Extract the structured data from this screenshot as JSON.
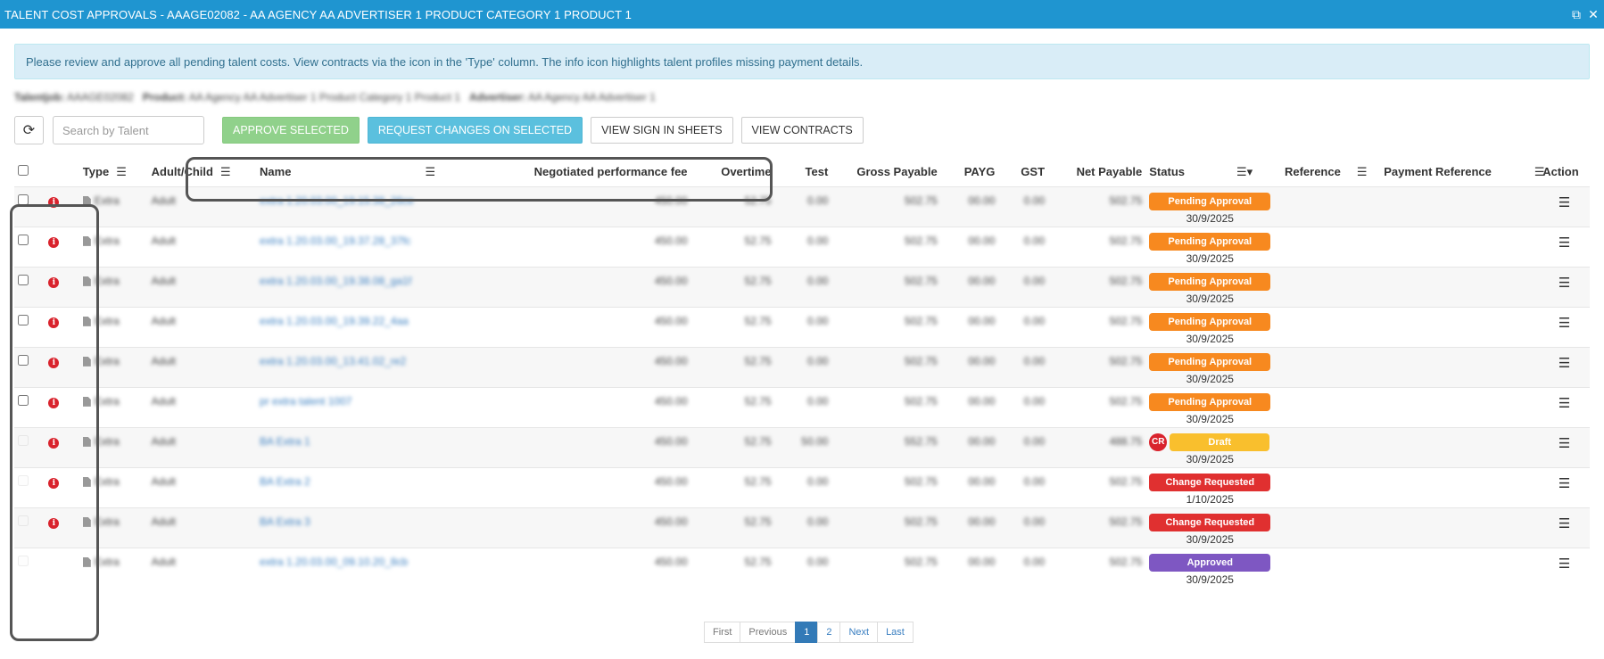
{
  "window": {
    "title": "TALENT COST APPROVALS - AAAGE02082 - AA AGENCY AA ADVERTISER 1 PRODUCT CATEGORY 1 PRODUCT 1",
    "restore_glyph": "⧉",
    "close_glyph": "✕"
  },
  "info_banner": "Please review and approve all pending talent costs. View contracts via the icon in the 'Type' column. The info icon highlights talent profiles missing payment details.",
  "meta_line": {
    "label1": "Talentjob:",
    "value1": "AAAGE02082",
    "label2": "Product:",
    "value2": "AA Agency AA Advertiser 1 Product Category 1 Product 1",
    "label3": "Advertiser:",
    "value3": "AA Agency AA Advertiser 1"
  },
  "toolbar": {
    "refresh_icon": "⟳",
    "search_placeholder": "Search by Talent",
    "approve_label": "APPROVE SELECTED",
    "request_label": "REQUEST CHANGES ON SELECTED",
    "signin_label": "VIEW SIGN IN SHEETS",
    "contracts_label": "VIEW CONTRACTS"
  },
  "columns": {
    "type": "Type",
    "adult_child": "Adult/Child",
    "name": "Name",
    "fee": "Negotiated performance fee",
    "overtime": "Overtime",
    "test": "Test",
    "gross": "Gross Payable",
    "payg": "PAYG",
    "gst": "GST",
    "net": "Net Payable",
    "status": "Status",
    "reference": "Reference",
    "payment_reference": "Payment Reference",
    "action": "Action",
    "menu_glyph": "☰",
    "filter_glyph": "☰▾"
  },
  "rows": [
    {
      "type": "Extra",
      "adult": "Adult",
      "name": "extra 1.20.03.00_19.15.38_26ce",
      "fee": "450.00",
      "overtime": "52.75",
      "test": "0.00",
      "gross": "502.75",
      "payg": "00.00",
      "gst": "0.00",
      "net": "502.75",
      "status": "Pending Approval",
      "date": "30/9/2025"
    },
    {
      "type": "Extra",
      "adult": "Adult",
      "name": "extra 1.20.03.00_19.37.28_37fc",
      "fee": "450.00",
      "overtime": "52.75",
      "test": "0.00",
      "gross": "502.75",
      "payg": "00.00",
      "gst": "0.00",
      "net": "502.75",
      "status": "Pending Approval",
      "date": "30/9/2025"
    },
    {
      "type": "Extra",
      "adult": "Adult",
      "name": "extra 1.20.03.00_19.38.08_ga1f",
      "fee": "450.00",
      "overtime": "52.75",
      "test": "0.00",
      "gross": "502.75",
      "payg": "00.00",
      "gst": "0.00",
      "net": "502.75",
      "status": "Pending Approval",
      "date": "30/9/2025"
    },
    {
      "type": "Extra",
      "adult": "Adult",
      "name": "extra 1.20.03.00_19.39.22_4aa",
      "fee": "450.00",
      "overtime": "52.75",
      "test": "0.00",
      "gross": "502.75",
      "payg": "00.00",
      "gst": "0.00",
      "net": "502.75",
      "status": "Pending Approval",
      "date": "30/9/2025"
    },
    {
      "type": "Extra",
      "adult": "Adult",
      "name": "extra 1.20.03.00_13.41.02_re2",
      "fee": "450.00",
      "overtime": "52.75",
      "test": "0.00",
      "gross": "502.75",
      "payg": "00.00",
      "gst": "0.00",
      "net": "502.75",
      "status": "Pending Approval",
      "date": "30/9/2025"
    },
    {
      "type": "Extra",
      "adult": "Adult",
      "name": "pr extra talent 1007",
      "fee": "450.00",
      "overtime": "52.75",
      "test": "0.00",
      "gross": "502.75",
      "payg": "00.00",
      "gst": "0.00",
      "net": "502.75",
      "status": "Pending Approval",
      "date": "30/9/2025"
    },
    {
      "type": "Extra",
      "adult": "Adult",
      "name": "BA Extra 1",
      "fee": "450.00",
      "overtime": "52.75",
      "test": "50.00",
      "gross": "552.75",
      "payg": "00.00",
      "gst": "0.00",
      "net": "488.75",
      "status": "Draft",
      "cr": "CR",
      "date": "30/9/2025"
    },
    {
      "type": "Extra",
      "adult": "Adult",
      "name": "BA Extra 2",
      "fee": "450.00",
      "overtime": "52.75",
      "test": "0.00",
      "gross": "502.75",
      "payg": "00.00",
      "gst": "0.00",
      "net": "502.75",
      "status": "Change Requested",
      "date": "1/10/2025"
    },
    {
      "type": "Extra",
      "adult": "Adult",
      "name": "BA Extra 3",
      "fee": "450.00",
      "overtime": "52.75",
      "test": "0.00",
      "gross": "502.75",
      "payg": "00.00",
      "gst": "0.00",
      "net": "502.75",
      "status": "Change Requested",
      "date": "30/9/2025"
    },
    {
      "type": "Extra",
      "adult": "Adult",
      "name": "extra 1.20.03.00_09.10.20_8cb",
      "fee": "450.00",
      "overtime": "52.75",
      "test": "0.00",
      "gross": "502.75",
      "payg": "00.00",
      "gst": "0.00",
      "net": "502.75",
      "status": "Approved",
      "date": "30/9/2025"
    }
  ],
  "row_flags": {
    "info_icon_rows": [
      true,
      true,
      true,
      true,
      true,
      true,
      true,
      true,
      true,
      false
    ],
    "enabled_checkbox_rows": [
      true,
      true,
      true,
      true,
      true,
      true,
      false,
      false,
      false,
      false
    ]
  },
  "status_colors": {
    "Pending Approval": "#f7891f",
    "Draft": "#f9bf2d",
    "Change Requested": "#e03030",
    "Approved": "#7e57c2"
  },
  "pagination": {
    "first": "First",
    "previous": "Previous",
    "page1": "1",
    "page2": "2",
    "next": "Next",
    "last": "Last"
  }
}
